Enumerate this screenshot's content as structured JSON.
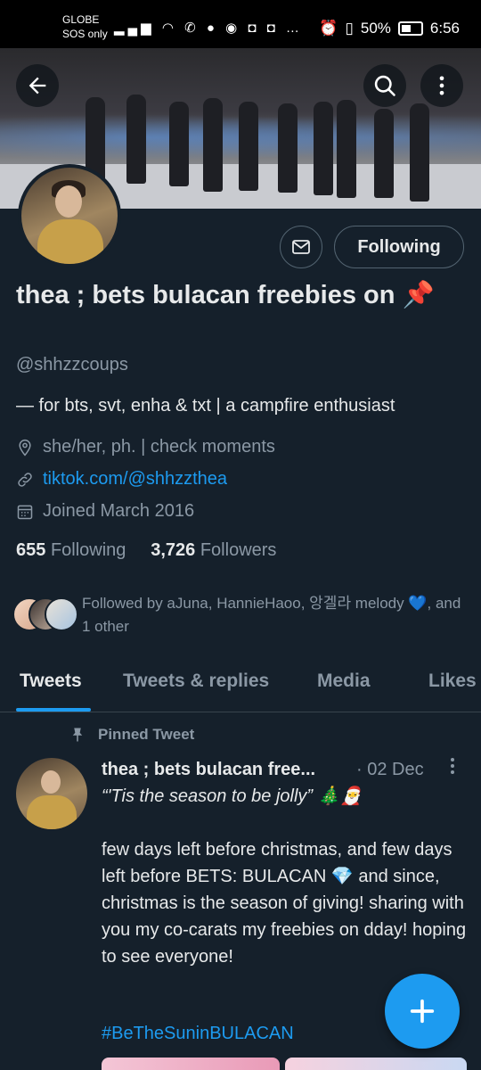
{
  "status_bar": {
    "carrier": "GLOBE",
    "carrier_sub": "SOS only",
    "battery": "50%",
    "time": "6:56",
    "icons": [
      "signal-icon",
      "wifi-icon",
      "viber-icon",
      "chat-icon",
      "messenger-icon",
      "instagram-icon",
      "instagram-icon",
      "more-icon",
      "alarm-icon",
      "vibrate-icon"
    ]
  },
  "profile": {
    "display_name": "thea ; bets bulacan freebies on 📌",
    "handle": "@shhzzcoups",
    "bio": "— for bts, svt, enha & txt | a campfire enthusiast",
    "location": "she/her, ph. | check moments",
    "website": "tiktok.com/@shhzzthea",
    "joined": "Joined March 2016",
    "following_count": "655",
    "following_label": "Following",
    "followers_count": "3,726",
    "followers_label": "Followers",
    "follow_button": "Following",
    "followed_by": "Followed by aJuna, HannieHaoo, 앙겔라 melody 💙, and 1 other"
  },
  "tabs": [
    {
      "label": "Tweets"
    },
    {
      "label": "Tweets & replies"
    },
    {
      "label": "Media"
    },
    {
      "label": "Likes"
    }
  ],
  "pinned_tweet": {
    "pinned_label": "Pinned Tweet",
    "author": "thea ; bets bulacan free...",
    "date": "· 02 Dec",
    "quote_line": "“'Tis the season to be jolly”  🎄🎅",
    "paragraph": "few days left before christmas, and few days left before BETS: BULACAN 💎 and since, christmas is the season of giving! sharing with you my co-carats my freebies on dday! hoping to see everyone!",
    "hashtag": "#BeTheSuninBULACAN"
  },
  "colors": {
    "background": "#15202b",
    "accent": "#1d9bf0",
    "secondary_text": "#8b98a5"
  }
}
